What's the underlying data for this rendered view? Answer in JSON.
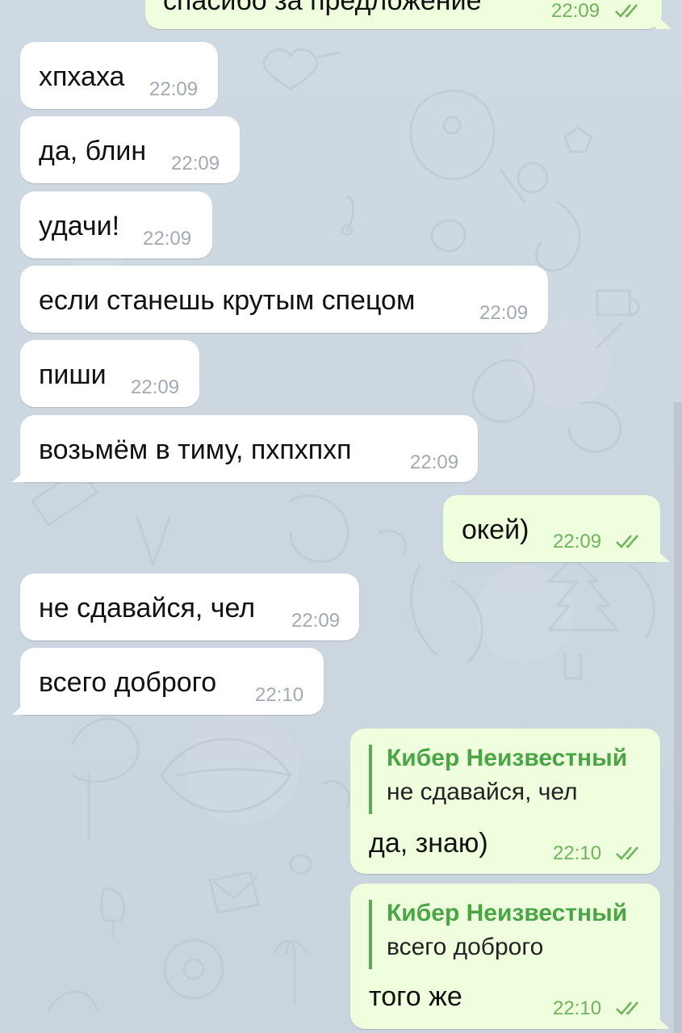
{
  "messages": [
    {
      "direction": "out",
      "text": "спасибо за предложение",
      "time": "22:09",
      "status": "double-check-icon"
    },
    {
      "direction": "in",
      "text": "хпхаха",
      "time": "22:09"
    },
    {
      "direction": "in",
      "text": "да, блин",
      "time": "22:09"
    },
    {
      "direction": "in",
      "text": "удачи!",
      "time": "22:09"
    },
    {
      "direction": "in",
      "text": "если станешь крутым спецом",
      "time": "22:09"
    },
    {
      "direction": "in",
      "text": "пиши",
      "time": "22:09"
    },
    {
      "direction": "in",
      "text": "возьмём в тиму, пхпхпхп",
      "time": "22:09"
    },
    {
      "direction": "out",
      "text": "окей)",
      "time": "22:09",
      "status": "double-check-icon"
    },
    {
      "direction": "in",
      "text": "не сдавайся, чел",
      "time": "22:09"
    },
    {
      "direction": "in",
      "text": "всего доброго",
      "time": "22:10"
    },
    {
      "direction": "out",
      "reply_name": "Кибер Неизвестный",
      "reply_text": "не сдавайся, чел",
      "text": "да, знаю)",
      "time": "22:10",
      "status": "double-check-icon"
    },
    {
      "direction": "out",
      "reply_name": "Кибер Неизвестный",
      "reply_text": "всего доброго",
      "text": "того же",
      "time": "22:10",
      "status": "double-check-icon"
    }
  ],
  "colors": {
    "incoming_bubble": "#ffffff",
    "outgoing_bubble": "#efffde",
    "reply_accent": "#4aa546",
    "timestamp_in": "#a1aab3",
    "timestamp_out": "#6fb35d",
    "background": "#cbd6df"
  }
}
